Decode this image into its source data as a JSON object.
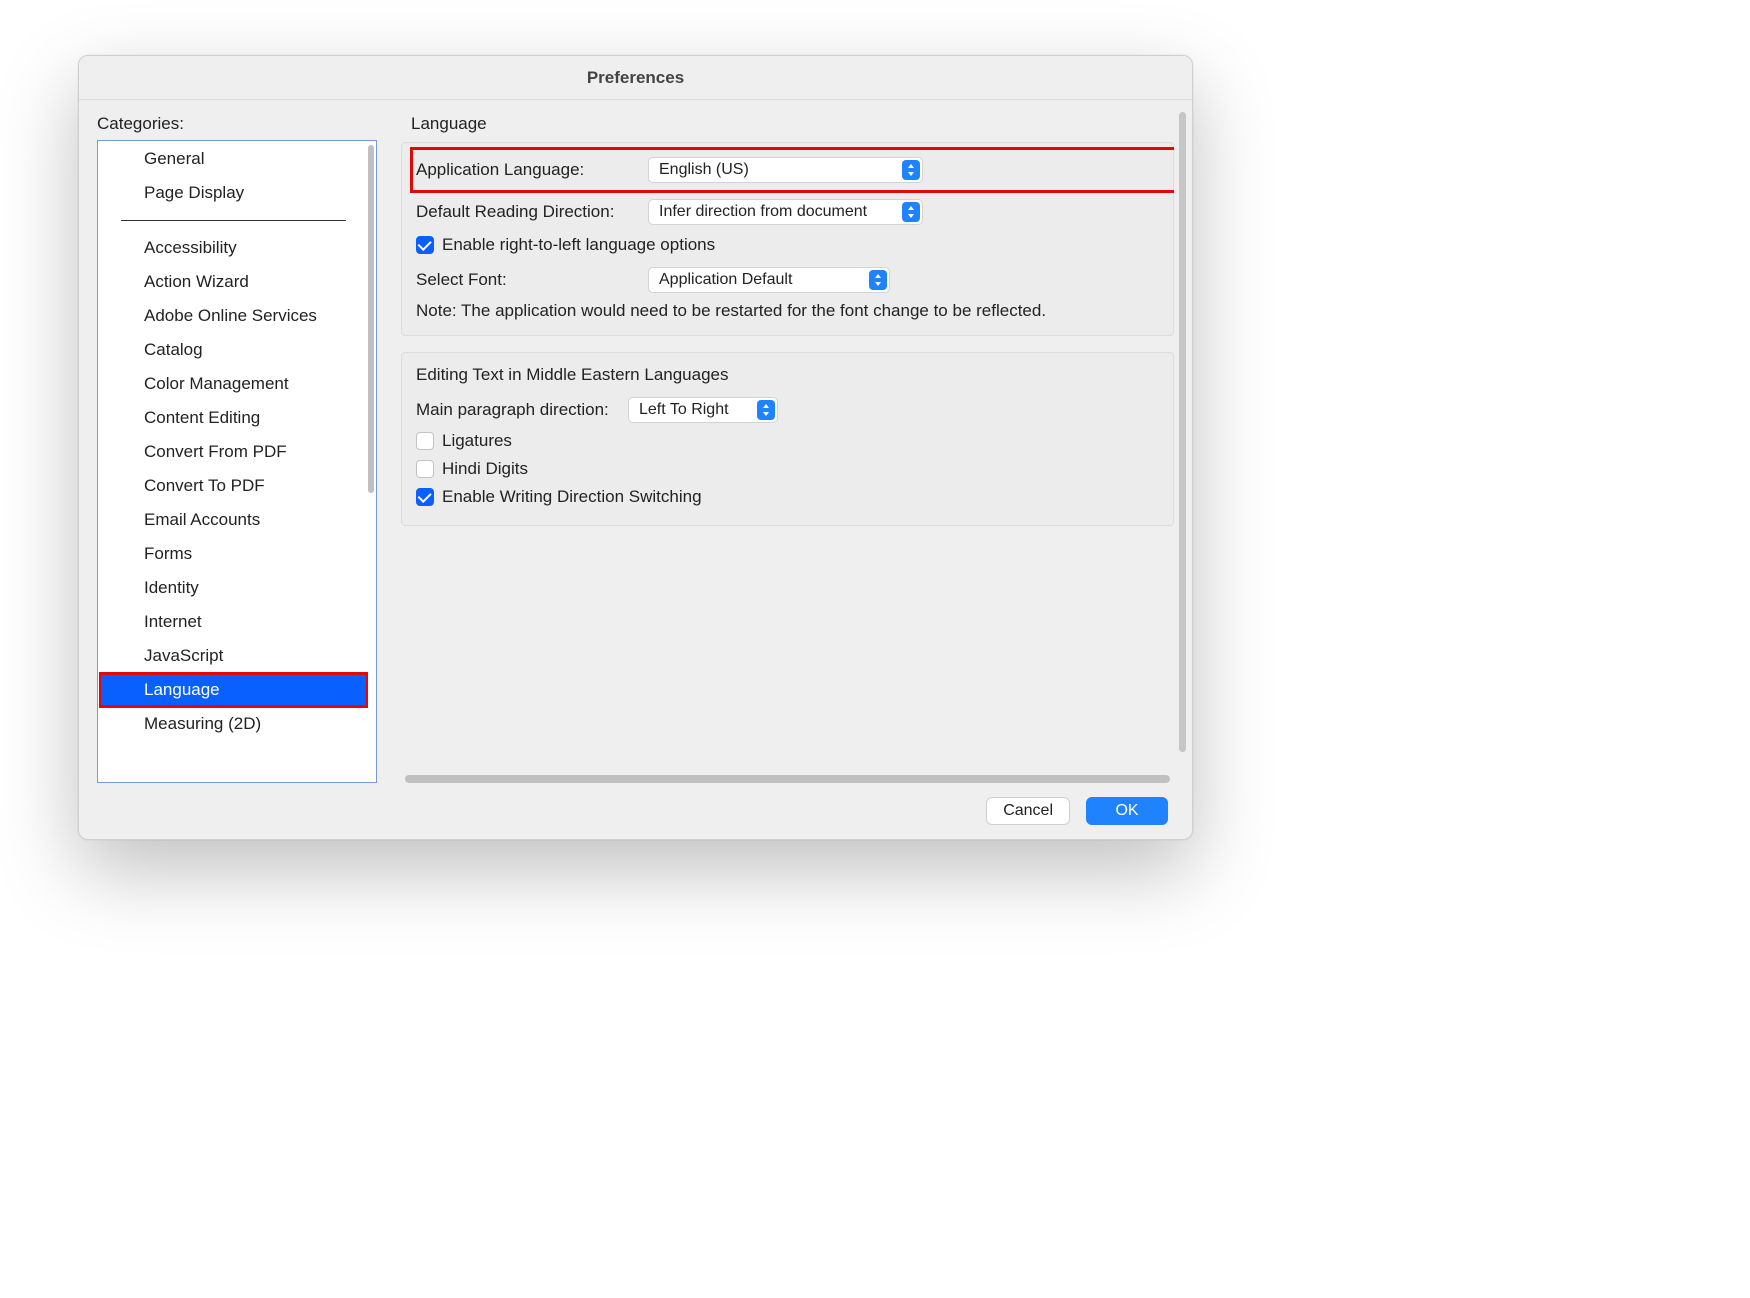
{
  "window": {
    "title": "Preferences"
  },
  "sidebar": {
    "label": "Categories:",
    "top": [
      "General",
      "Page Display"
    ],
    "items": [
      "Accessibility",
      "Action Wizard",
      "Adobe Online Services",
      "Catalog",
      "Color Management",
      "Content Editing",
      "Convert From PDF",
      "Convert To PDF",
      "Email Accounts",
      "Forms",
      "Identity",
      "Internet",
      "JavaScript",
      "Language",
      "Measuring (2D)"
    ],
    "selected": "Language"
  },
  "panel": {
    "title": "Language",
    "appLang": {
      "label": "Application Language:",
      "value": "English (US)"
    },
    "readDir": {
      "label": "Default Reading Direction:",
      "value": "Infer direction from document"
    },
    "rtl": {
      "label": "Enable right-to-left language options",
      "checked": true
    },
    "font": {
      "label": "Select Font:",
      "value": "Application Default"
    },
    "note": "Note: The application would need to be restarted for the font change to be reflected.",
    "group2": {
      "title": "Editing Text in Middle Eastern Languages",
      "paraDir": {
        "label": "Main paragraph direction:",
        "value": "Left To Right"
      },
      "ligatures": {
        "label": "Ligatures",
        "checked": false
      },
      "hindi": {
        "label": "Hindi Digits",
        "checked": false
      },
      "switch": {
        "label": "Enable Writing Direction Switching",
        "checked": true
      }
    }
  },
  "footer": {
    "cancel": "Cancel",
    "ok": "OK"
  }
}
